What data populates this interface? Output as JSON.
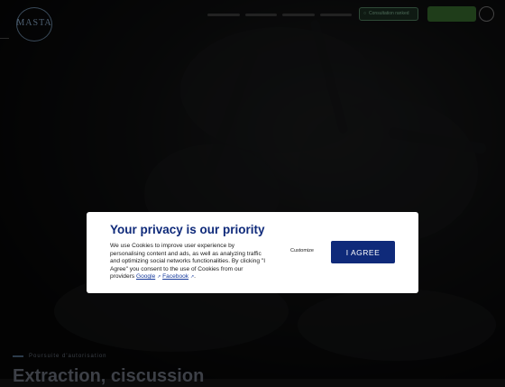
{
  "header": {
    "logo_text": "MASTA",
    "online_button_label": "Consultation ranked",
    "online_icon": "chat-icon"
  },
  "hero": {
    "eyebrow": "Poursuite d'autorisation",
    "headline": "Extraction, ciscussion"
  },
  "privacy_modal": {
    "title": "Your privacy is our priority",
    "body_text": "We use Cookies to improve user experience by personalising content and ads, as well as analyzing traffic and optimizing social networks functionalities. By clicking \"I Agree\" you consent to the use of Cookies from our providers",
    "provider_google": "Google",
    "provider_facebook": "Facebook",
    "external_link_icon": "external-link-icon",
    "customize_label": "Customize",
    "agree_label": "I AGREE"
  },
  "colors": {
    "accent": "#0f2a7a",
    "backdrop": "#0b0b0b",
    "modal_bg": "#ffffff"
  }
}
